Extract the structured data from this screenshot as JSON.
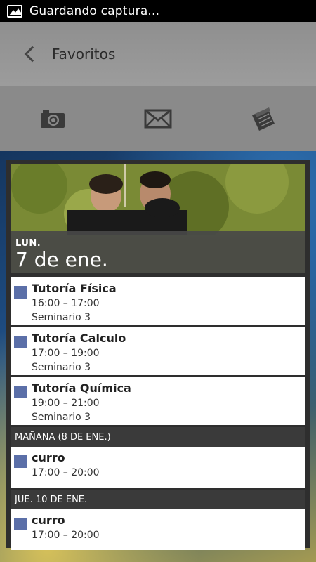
{
  "status_bar": {
    "text": "Guardando captura..."
  },
  "action_bar": {
    "title": "Favoritos"
  },
  "share": {
    "icons": [
      "camera-icon",
      "mail-icon",
      "book-icon"
    ]
  },
  "widget": {
    "day": "LUN.",
    "date": "7 de ene.",
    "today_events": [
      {
        "title": "Tutoría Física",
        "time": "16:00 – 17:00",
        "location": "Seminario 3"
      },
      {
        "title": "Tutoría Calculo",
        "time": "17:00 – 19:00",
        "location": "Seminario 3"
      },
      {
        "title": "Tutoría Química",
        "time": "19:00 – 21:00",
        "location": "Seminario 3"
      }
    ],
    "tomorrow_header": "MAÑANA (8 DE ENE.)",
    "tomorrow_events": [
      {
        "title": "curro",
        "time": "17:00 – 20:00"
      }
    ],
    "thursday_header": "JUE. 10 DE ENE.",
    "thursday_events": [
      {
        "title": "curro",
        "time": "17:00 – 20:00"
      }
    ]
  },
  "colors": {
    "event_swatch": "#5b6fa8",
    "status_bar": "#000000",
    "action_bar": "#969696"
  }
}
